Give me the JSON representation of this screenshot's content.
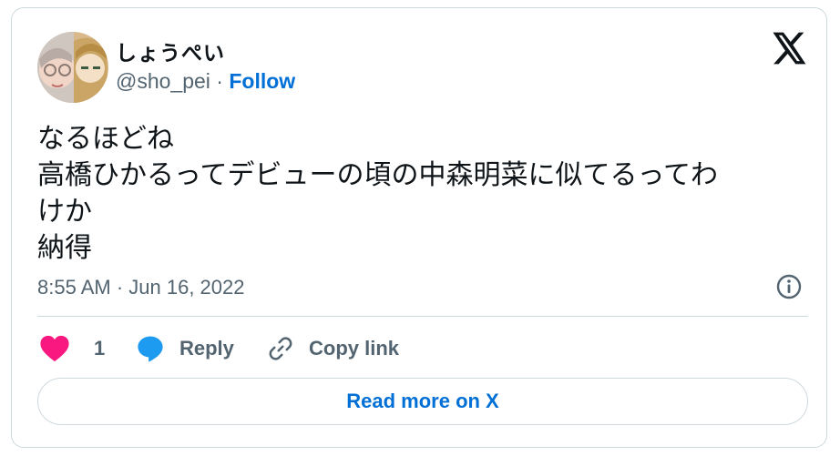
{
  "author": {
    "display_name": "しょうぺい",
    "handle": "@sho_pei",
    "separator": " · ",
    "follow_label": "Follow"
  },
  "tweet": {
    "lines": [
      "なるほどね",
      "高橋ひかるってデビューの頃の中森明菜に似てるってわ",
      "けか",
      "納得"
    ],
    "time": "8:55 AM",
    "date_separator": " · ",
    "date": "Jun 16, 2022"
  },
  "actions": {
    "like_count": "1",
    "reply_label": "Reply",
    "copy_label": "Copy link"
  },
  "read_more_label": "Read more on X",
  "colors": {
    "link": "#006fd6",
    "like": "#f91880",
    "reply": "#1d9bf0",
    "muted": "#536471",
    "border": "#cfd9de"
  },
  "icons": [
    "avatar",
    "x-logo-icon",
    "info-icon",
    "heart-icon",
    "reply-bubble-icon",
    "link-icon"
  ]
}
